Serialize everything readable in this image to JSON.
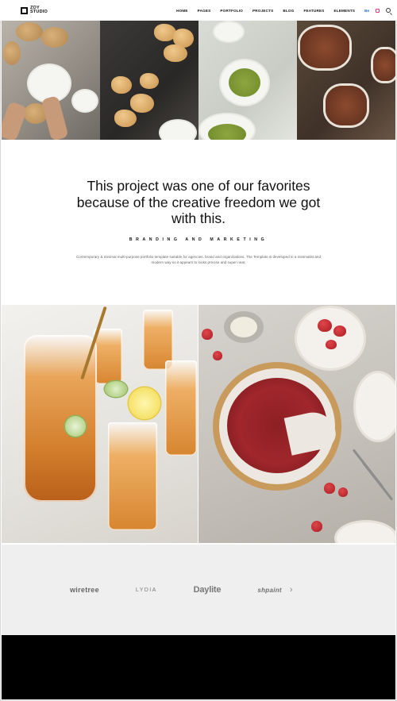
{
  "header": {
    "logo_line1": "ZOY",
    "logo_line2": "STUDIO",
    "nav": [
      "HOME",
      "PAGES",
      "PORTFOLIO",
      "PROJECTS",
      "BLOG",
      "FEATURES",
      "ELEMENTS"
    ],
    "social": {
      "behance": "Be",
      "instagram_icon": "instagram-icon",
      "search_icon": "search-icon"
    }
  },
  "quote": {
    "title": "This project was one of our favorites because of the creative freedom we got with this.",
    "kicker": "BRANDING AND MARKETING",
    "description": "Contemporary & minimal multi-purpose portfolio template suitable for agencies, brand and organizations. The Template is developed in a minimalist and modern way so it appears to looks precise and super neat."
  },
  "clients": {
    "logos": [
      "wiretree",
      "LYDIA",
      "Daylite",
      "shpaint"
    ],
    "next_icon": "chevron-right-icon",
    "next_glyph": "›"
  }
}
